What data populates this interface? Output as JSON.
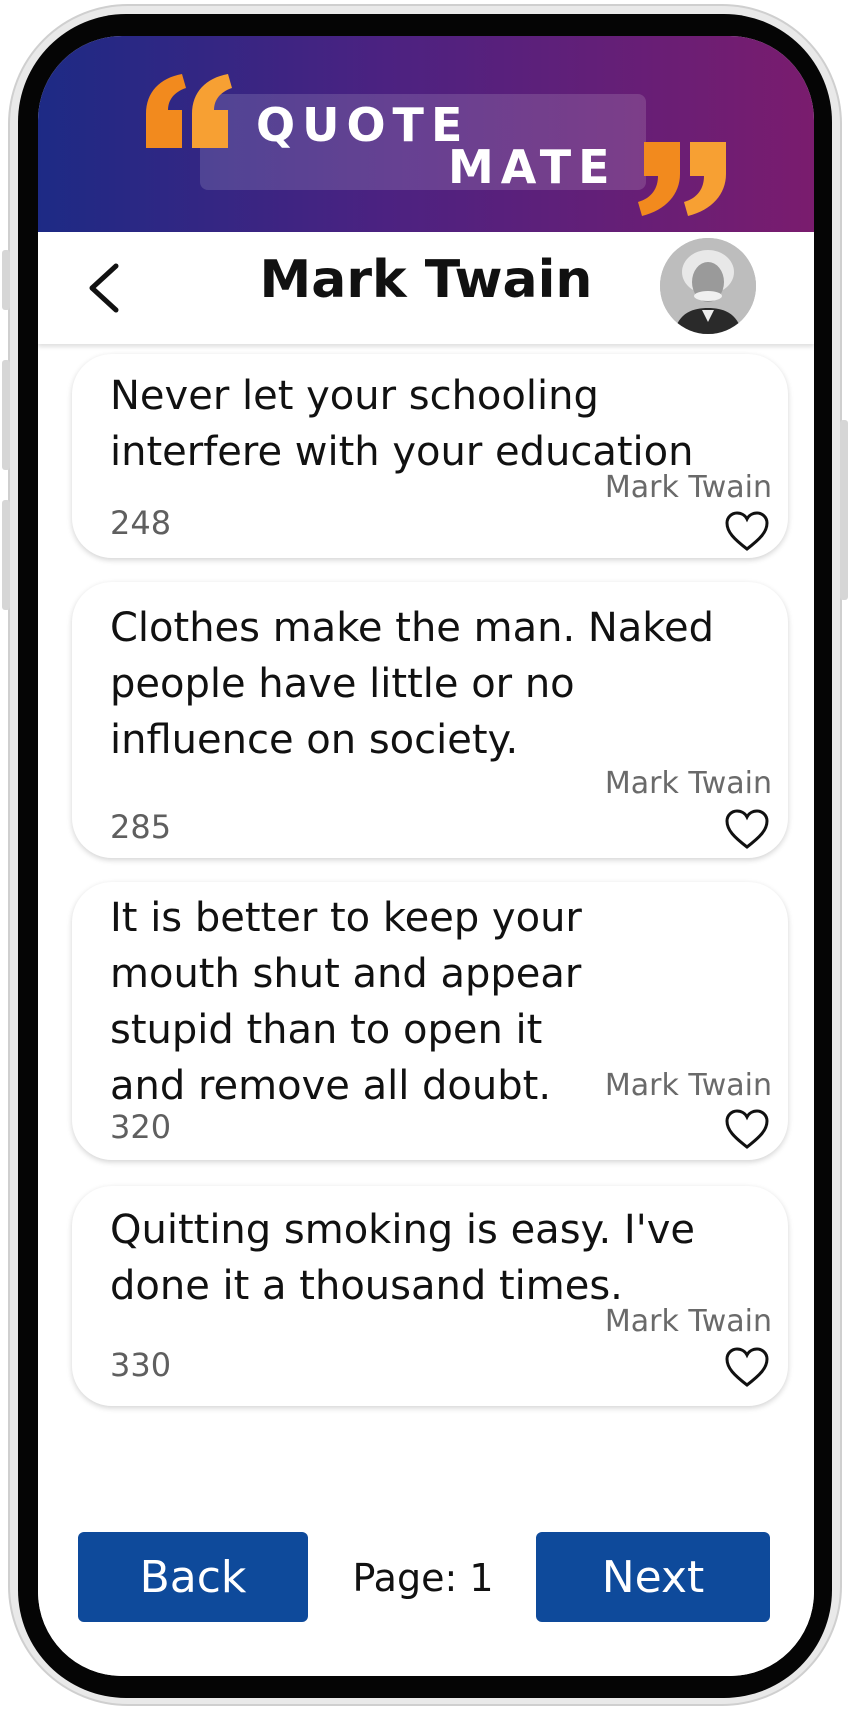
{
  "brand": {
    "line1": "QUOTE",
    "line2": "MATE",
    "colors": {
      "gradient_start": "#1d2a85",
      "gradient_end": "#7a1c6e",
      "quote_marks": "#f28a1e"
    }
  },
  "topbar": {
    "back_icon": "chevron-left-icon",
    "title": "Mark Twain",
    "avatar": "author-portrait"
  },
  "quotes": [
    {
      "text": "Never let your schooling interfere with your education",
      "author": "Mark Twain",
      "likes": "248",
      "icon": "heart-outline-icon"
    },
    {
      "text": "Clothes make the man. Naked people have little or no influence on society.",
      "author": "Mark Twain",
      "likes": "285",
      "icon": "heart-outline-icon"
    },
    {
      "text": "It is better to keep your mouth shut and appear stupid than to open it and remove all doubt.",
      "author": "Mark Twain",
      "likes": "320",
      "icon": "heart-outline-icon"
    },
    {
      "text": "Quitting smoking is easy. I've done it a thousand times.",
      "author": "Mark Twain",
      "likes": "330",
      "icon": "heart-outline-icon"
    }
  ],
  "pagination": {
    "back_label": "Back",
    "page_label": "Page: 1",
    "next_label": "Next",
    "button_color": "#0e4a9b"
  }
}
